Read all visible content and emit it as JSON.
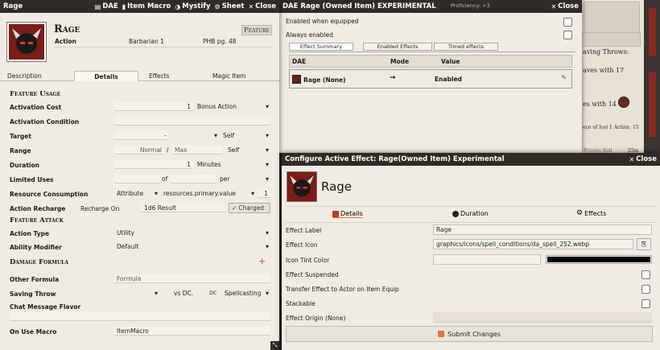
{
  "item_sheet": {
    "title": "Rage",
    "header_buttons": {
      "dae": "DAE",
      "item_macro": "Item Macro",
      "mystify": "Mystify",
      "sheet": "Sheet",
      "close": "Close"
    },
    "name": "Rage",
    "type_badge": "Feature",
    "meta": {
      "type": "Action",
      "requirement": "Barbarian 1",
      "source": "PHB pg. 48"
    },
    "tabs": [
      "Description",
      "Details",
      "Effects",
      "Magic Item"
    ],
    "active_tab": "Details",
    "sections": {
      "usage": "Feature Usage",
      "attack": "Feature Attack",
      "damage": "Damage Formula"
    },
    "fields": {
      "activation_cost": {
        "label": "Activation Cost",
        "value": "1",
        "unit": "Bonus Action"
      },
      "activation_condition": {
        "label": "Activation Condition",
        "value": ""
      },
      "target": {
        "label": "Target",
        "value": "-",
        "unit": "Self"
      },
      "range": {
        "label": "Range",
        "normal": "Normal",
        "sep": "/",
        "max": "Max",
        "unit": "Self"
      },
      "duration": {
        "label": "Duration",
        "value": "1",
        "unit": "Minutes"
      },
      "limited_uses": {
        "label": "Limited Uses",
        "of": "of",
        "per": "per"
      },
      "resource_consumption": {
        "label": "Resource Consumption",
        "type": "Attribute",
        "target": "resources.primary.value",
        "amount": "1"
      },
      "action_recharge": {
        "label": "Action Recharge",
        "recharge_on": "Recharge On",
        "result": "1d6 Result",
        "charged": "Charged"
      },
      "action_type": {
        "label": "Action Type",
        "value": "Utility"
      },
      "ability_modifier": {
        "label": "Ability Modifier",
        "value": "Default"
      },
      "other_formula": {
        "label": "Other Formula",
        "placeholder": "Formula"
      },
      "saving_throw": {
        "label": "Saving Throw",
        "vs": "vs DC.",
        "dc": "DC",
        "scaling": "Spellcasting"
      },
      "chat_flavor": {
        "label": "Chat Message Flavor"
      },
      "on_use_macro": {
        "label": "On Use Macro",
        "value": "ItemMacro"
      }
    }
  },
  "dae_window": {
    "title": "DAE Rage (Owned Item) EXPERIMENTAL",
    "close": "Close",
    "enabled_when_equipped": "Enabled when equipped",
    "always_enabled": "Always enabled",
    "tabs": [
      "Effect Summary",
      "Enabled Effects",
      "Timed effects"
    ],
    "columns": [
      "DAE",
      "Mode",
      "Value"
    ],
    "row": {
      "name": "Rage (None)",
      "mode": "→",
      "value": "Enabled"
    }
  },
  "effect_window": {
    "title": "Configure Active Effect: Rage(Owned Item) Experimental",
    "close": "Close",
    "name": "Rage",
    "tabs": [
      "Details",
      "Duration",
      "Effects"
    ],
    "fields": {
      "effect_label": {
        "label": "Effect Label",
        "value": "Rage"
      },
      "effect_icon": {
        "label": "Effect Icon",
        "value": "graphics/icons/spell_conditions/da_spell_252.webp"
      },
      "tint": {
        "label": "Icon Tint Color"
      },
      "suspended": {
        "label": "Effect Suspended"
      },
      "transfer": {
        "label": "Transfer Effect to Actor on Item Equip"
      },
      "stackable": {
        "label": "Stackable"
      },
      "origin": {
        "label": "Effect Origin (None)"
      }
    },
    "submit": "Submit Changes"
  },
  "background": {
    "proficiency": "Proficiency: +3",
    "saving_throws": "aving Throws:",
    "aves_with": "aves with 17",
    "es_with": "es with 14",
    "ice_row": {
      "name": "ece of Ice)",
      "action": "1 Action",
      "value": "15"
    },
    "private_roll": "Private Roll",
    "private_value": "25m"
  },
  "colors": {
    "header": "#2f2b27",
    "accent": "#e8703a",
    "panel": "#f0ece4"
  }
}
